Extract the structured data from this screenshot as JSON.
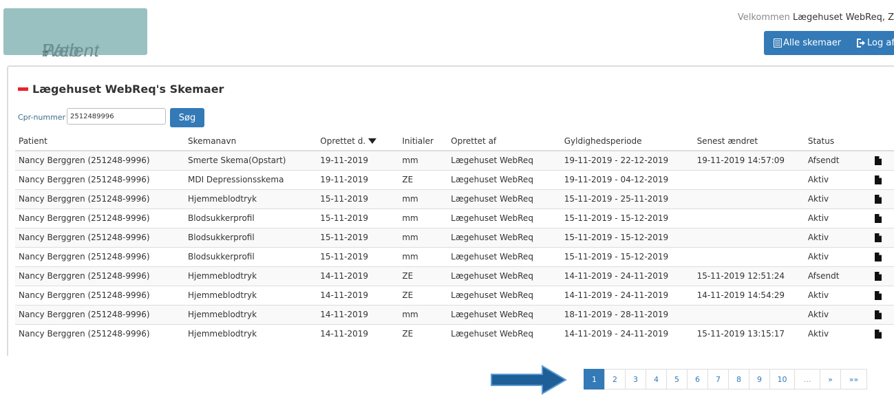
{
  "header": {
    "logo_text_1": "Web",
    "logo_text_2": "-",
    "logo_text_3": "Patient",
    "welcome_prefix": "Velkommen",
    "welcome_name": "Lægehuset WebReq, Z",
    "btn_all_forms": "Alle skemaer",
    "btn_logout": "Log af"
  },
  "panel": {
    "title": "Lægehuset WebReq's Skemaer",
    "cpr_label": "Cpr-nummer",
    "cpr_value": "2512489996",
    "search_button": "Søg"
  },
  "table": {
    "columns": [
      "Patient",
      "Skemanavn",
      "Oprettet d.",
      "Initialer",
      "Oprettet af",
      "Gyldighedsperiode",
      "Senest ændret",
      "Status"
    ],
    "rows": [
      [
        "Nancy Berggren (251248-9996)",
        "Smerte Skema(Opstart)",
        "19-11-2019",
        "mm",
        "Lægehuset WebReq",
        "19-11-2019 - 22-12-2019",
        "19-11-2019 14:57:09",
        "Afsendt"
      ],
      [
        "Nancy Berggren (251248-9996)",
        "MDI Depressionsskema",
        "19-11-2019",
        "ZE",
        "Lægehuset WebReq",
        "19-11-2019 - 04-12-2019",
        "",
        "Aktiv"
      ],
      [
        "Nancy Berggren (251248-9996)",
        "Hjemmeblodtryk",
        "15-11-2019",
        "mm",
        "Lægehuset WebReq",
        "15-11-2019 - 25-11-2019",
        "",
        "Aktiv"
      ],
      [
        "Nancy Berggren (251248-9996)",
        "Blodsukkerprofil",
        "15-11-2019",
        "mm",
        "Lægehuset WebReq",
        "15-11-2019 - 15-12-2019",
        "",
        "Aktiv"
      ],
      [
        "Nancy Berggren (251248-9996)",
        "Blodsukkerprofil",
        "15-11-2019",
        "mm",
        "Lægehuset WebReq",
        "15-11-2019 - 15-12-2019",
        "",
        "Aktiv"
      ],
      [
        "Nancy Berggren (251248-9996)",
        "Blodsukkerprofil",
        "15-11-2019",
        "mm",
        "Lægehuset WebReq",
        "15-11-2019 - 15-12-2019",
        "",
        "Aktiv"
      ],
      [
        "Nancy Berggren (251248-9996)",
        "Hjemmeblodtryk",
        "14-11-2019",
        "ZE",
        "Lægehuset WebReq",
        "14-11-2019 - 24-11-2019",
        "15-11-2019 12:51:24",
        "Afsendt"
      ],
      [
        "Nancy Berggren (251248-9996)",
        "Hjemmeblodtryk",
        "14-11-2019",
        "ZE",
        "Lægehuset WebReq",
        "14-11-2019 - 24-11-2019",
        "14-11-2019 14:54:29",
        "Aktiv"
      ],
      [
        "Nancy Berggren (251248-9996)",
        "Hjemmeblodtryk",
        "14-11-2019",
        "mm",
        "Lægehuset WebReq",
        "18-11-2019 - 28-11-2019",
        "",
        "Aktiv"
      ],
      [
        "Nancy Berggren (251248-9996)",
        "Hjemmeblodtryk",
        "14-11-2019",
        "ZE",
        "Lægehuset WebReq",
        "14-11-2019 - 24-11-2019",
        "15-11-2019 13:15:17",
        "Aktiv"
      ]
    ]
  },
  "pagination": {
    "pages": [
      "1",
      "2",
      "3",
      "4",
      "5",
      "6",
      "7",
      "8",
      "9",
      "10",
      "…",
      "»",
      "»»"
    ],
    "active": "1"
  },
  "icons": {
    "document": "file-icon",
    "all_forms": "list-icon",
    "logout": "logout-icon",
    "sort": "sort-desc-icon",
    "annotation_arrow": "arrow-right-icon"
  },
  "colors": {
    "primary": "#337ab7",
    "logo_bg": "#99c1c1",
    "title_accent": "#e8242e",
    "arrow_fill": "#1f5f98"
  }
}
